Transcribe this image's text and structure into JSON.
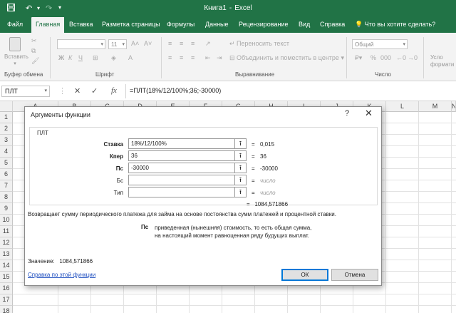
{
  "titlebar": {
    "workbook": "Книга1",
    "separator": "-",
    "app": "Excel",
    "icons": [
      "save-icon",
      "undo-icon",
      "redo-icon",
      "customize-qat-icon"
    ]
  },
  "tabs": [
    {
      "label": "Файл"
    },
    {
      "label": "Главная"
    },
    {
      "label": "Вставка"
    },
    {
      "label": "Разметка страницы"
    },
    {
      "label": "Формулы"
    },
    {
      "label": "Данные"
    },
    {
      "label": "Рецензирование"
    },
    {
      "label": "Вид"
    },
    {
      "label": "Справка"
    }
  ],
  "tell_me": "Что вы хотите сделать?",
  "ribbon": {
    "paste_label": "Вставить",
    "font_size": "11",
    "bold": "Ж",
    "italic": "К",
    "underline": "Ч",
    "wrap_text": "Переносить текст",
    "merge_center": "Объединить и поместить в центре",
    "number_format": "Общий",
    "conditional_format_1": "Усло",
    "conditional_format_2": "формати",
    "groups": {
      "clipboard": "Буфер обмена",
      "font": "Шрифт",
      "alignment": "Выравнивание",
      "number": "Число"
    }
  },
  "formula_bar": {
    "name_box": "ПЛТ",
    "cancel": "✕",
    "enter": "✓",
    "fx": "fx",
    "formula": "=ПЛТ(18%/12/100%;36;-30000)"
  },
  "grid": {
    "columns": [
      "A",
      "B",
      "C",
      "D",
      "E",
      "F",
      "G",
      "H",
      "I",
      "J",
      "K",
      "L",
      "M",
      "N"
    ],
    "rows": [
      "1",
      "2",
      "3",
      "4",
      "5",
      "6",
      "7",
      "8",
      "9",
      "10",
      "11",
      "12",
      "13",
      "14",
      "15",
      "16",
      "17",
      "18"
    ]
  },
  "dialog": {
    "title": "Аргументы функции",
    "help": "?",
    "close": "✕",
    "function_name": "ПЛТ",
    "args": [
      {
        "label": "Ставка",
        "bold": true,
        "value": "18%/12/100%",
        "result": "0,015",
        "hint": false
      },
      {
        "label": "Кпер",
        "bold": true,
        "value": "36",
        "result": "36",
        "hint": false
      },
      {
        "label": "Пс",
        "bold": true,
        "value": "-30000",
        "result": "-30000",
        "hint": false
      },
      {
        "label": "Бс",
        "bold": false,
        "value": "",
        "result": "число",
        "hint": true
      },
      {
        "label": "Тип",
        "bold": false,
        "value": "",
        "result": "число",
        "hint": true
      }
    ],
    "equals": "=",
    "formula_result": "1084,571866",
    "description": "Возвращает сумму периодического платежа для займа на основе постоянства сумм платежей и процентной ставки.",
    "arg_name": "Пс",
    "arg_description": "приведенная (нынешняя) стоимость, то есть общая сумма, на настоящий момент равноценная ряду будущих выплат.",
    "value_label": "Значение:",
    "value": "1084,571866",
    "help_link": "Справка по этой функции",
    "ok": "ОК",
    "cancel": "Отмена"
  },
  "colors": {
    "excel_green": "#217346",
    "ribbon_bg": "#f3f3f3",
    "link_blue": "#1f4fc0",
    "focus_blue": "#0078d7"
  }
}
